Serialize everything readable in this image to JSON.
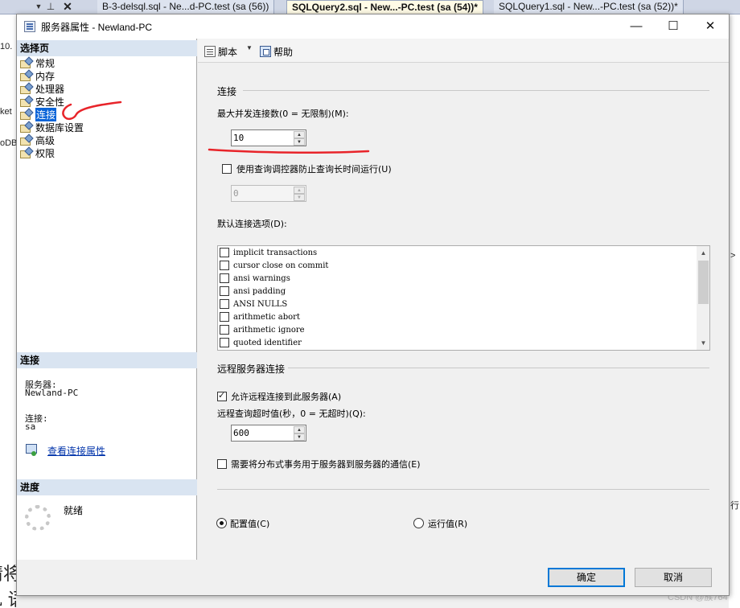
{
  "ide": {
    "tabs": [
      {
        "label": "B-3-delsql.sql - Ne...d-PC.test (sa (56))"
      },
      {
        "label": "SQLQuery2.sql - New...-PC.test (sa (54))*"
      },
      {
        "label": "SQLQuery1.sql - New...-PC.test (sa (52))*"
      }
    ],
    "left_fragments": [
      "10.",
      "ket",
      "oDB"
    ],
    "right_fragments": [
      ">",
      "行"
    ],
    "doc_fragments": [
      "请将",
      "L 语句和执行结果。↩"
    ],
    "watermark": "CSDN @族764"
  },
  "dialog": {
    "title": "服务器属性 - Newland-PC",
    "minimize": "—",
    "maximize": "☐",
    "close": "✕",
    "select_page": {
      "header": "选择页",
      "items": [
        {
          "label": "常规"
        },
        {
          "label": "内存"
        },
        {
          "label": "处理器"
        },
        {
          "label": "安全性"
        },
        {
          "label": "连接",
          "selected": true
        },
        {
          "label": "数据库设置"
        },
        {
          "label": "高级"
        },
        {
          "label": "权限"
        }
      ]
    },
    "connection": {
      "header": "连接",
      "server_label": "服务器:",
      "server_value": "Newland-PC",
      "connection_label": "连接:",
      "connection_value": "sa",
      "view_link": "查看连接属性"
    },
    "progress": {
      "header": "进度",
      "status": "就绪"
    },
    "toolbar": {
      "script_label": "脚本",
      "help_label": "帮助"
    },
    "content": {
      "connections_group": "连接",
      "max_connections_label": "最大并发连接数(0 = 无限制)(M):",
      "max_connections_value": "10",
      "query_governor_label": "使用查询调控器防止查询长时间运行(U)",
      "query_governor_checked": false,
      "query_governor_value": "0",
      "default_options_label": "默认连接选项(D):",
      "default_options": [
        {
          "label": "implicit transactions",
          "checked": false
        },
        {
          "label": "cursor close on commit",
          "checked": false
        },
        {
          "label": "ansi warnings",
          "checked": false
        },
        {
          "label": "ansi padding",
          "checked": false
        },
        {
          "label": "ANSI NULLS",
          "checked": false
        },
        {
          "label": "arithmetic abort",
          "checked": false
        },
        {
          "label": "arithmetic ignore",
          "checked": false
        },
        {
          "label": "quoted identifier",
          "checked": false
        }
      ],
      "remote_group": "远程服务器连接",
      "allow_remote_label": "允许远程连接到此服务器(A)",
      "allow_remote_checked": true,
      "remote_timeout_label": "远程查询超时值(秒，0 = 无超时)(Q):",
      "remote_timeout_value": "600",
      "distributed_tx_label": "需要将分布式事务用于服务器到服务器的通信(E)",
      "distributed_tx_checked": false,
      "config_value_label": "配置值(C)",
      "running_value_label": "运行值(R)",
      "selected_value_mode": "config"
    },
    "buttons": {
      "ok": "确定",
      "cancel": "取消"
    }
  },
  "colors": {
    "selection": "#0a64d8",
    "pane_header": "#d9e4f1",
    "annotation_red": "#e8242a",
    "link": "#0033aa"
  }
}
